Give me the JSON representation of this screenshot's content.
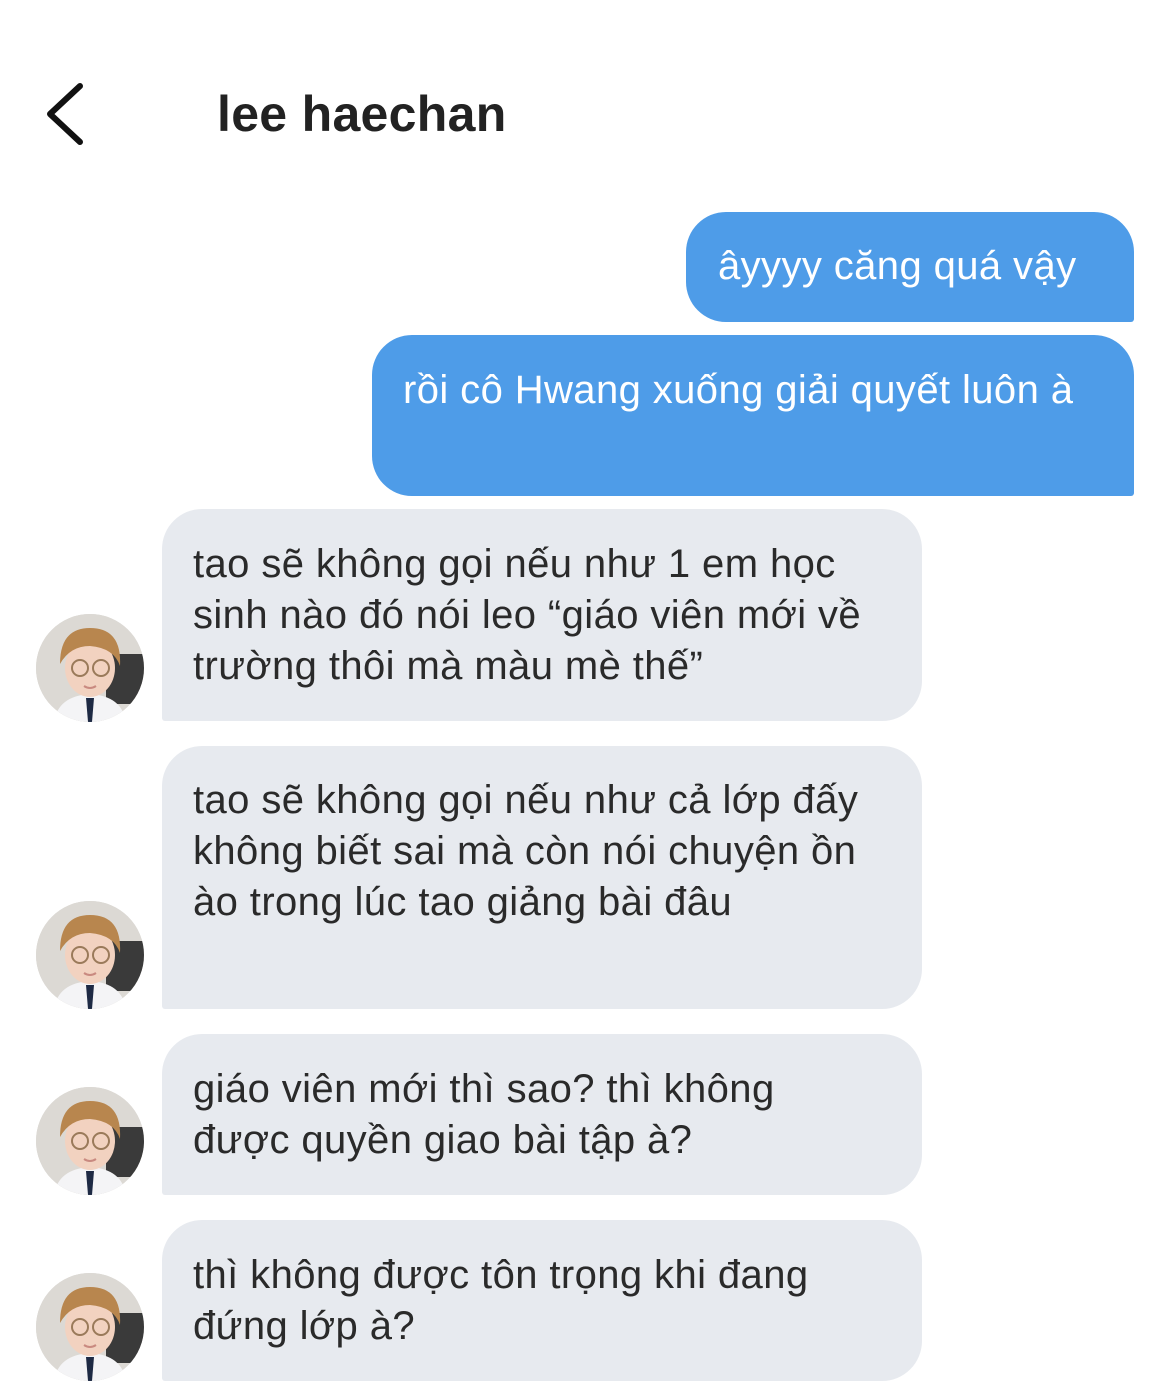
{
  "header": {
    "back_icon": "chevron-left-icon",
    "contact_name": "lee haechan"
  },
  "messages": [
    {
      "direction": "outgoing",
      "text": "âyyyy căng quá vậy"
    },
    {
      "direction": "outgoing",
      "text": "rồi cô Hwang xuống giải quyết luôn à"
    },
    {
      "direction": "incoming",
      "text": "tao sẽ không gọi nếu như 1 em học sinh nào đó nói leo “giáo viên mới về trường thôi mà màu mè thế”"
    },
    {
      "direction": "incoming",
      "text": "tao sẽ không gọi nếu như cả lớp đấy không biết sai mà còn nói chuyện ồn ào trong lúc tao giảng bài đâu"
    },
    {
      "direction": "incoming",
      "text": "giáo viên mới thì sao? thì không được quyền giao bài tập à?"
    },
    {
      "direction": "incoming",
      "text": "thì không được tôn trọng khi đang đứng lớp à?"
    }
  ],
  "colors": {
    "outgoing_bubble": "#4e9ce8",
    "incoming_bubble": "#e7eaef",
    "background": "#ffffff"
  }
}
